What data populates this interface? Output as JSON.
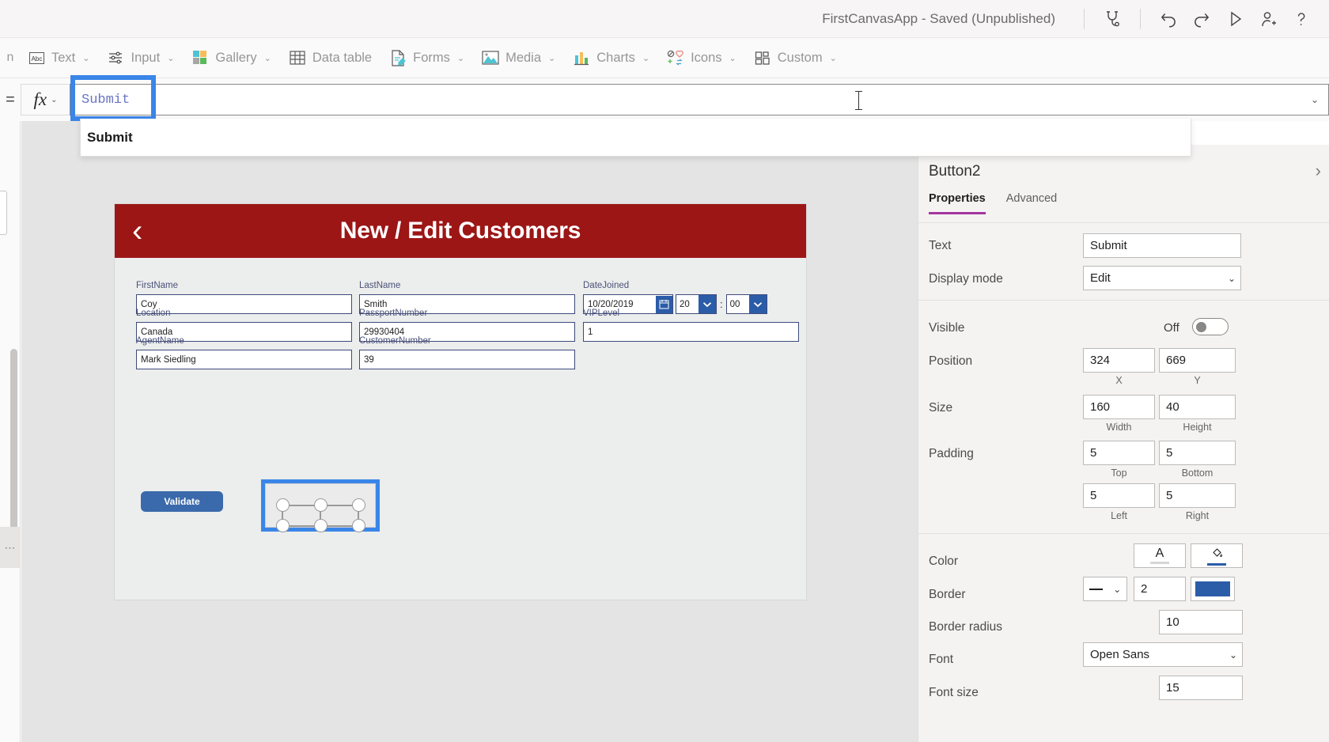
{
  "topbar": {
    "app_title": "FirstCanvasApp - Saved (Unpublished)",
    "icons": [
      {
        "name": "app-checker-icon",
        "label": "App checker"
      },
      {
        "name": "undo-icon",
        "label": "Undo"
      },
      {
        "name": "redo-icon",
        "label": "Redo"
      },
      {
        "name": "preview-play-icon",
        "label": "Preview the app"
      },
      {
        "name": "share-add-user-icon",
        "label": "Share"
      },
      {
        "name": "help-icon",
        "label": "Help"
      }
    ]
  },
  "insert_toolbar": {
    "overflow_left": "n",
    "items": [
      {
        "label": "Text",
        "icon": "text-abc-icon",
        "has_chevron": true
      },
      {
        "label": "Input",
        "icon": "input-sliders-icon",
        "has_chevron": true
      },
      {
        "label": "Gallery",
        "icon": "gallery-squares-icon",
        "has_chevron": true
      },
      {
        "label": "Data table",
        "icon": "data-table-grid-icon",
        "has_chevron": false
      },
      {
        "label": "Forms",
        "icon": "forms-pencil-icon",
        "has_chevron": true
      },
      {
        "label": "Media",
        "icon": "media-image-icon",
        "has_chevron": true
      },
      {
        "label": "Charts",
        "icon": "charts-bar-icon",
        "has_chevron": true
      },
      {
        "label": "Icons",
        "icon": "icons-shapes-icon",
        "has_chevron": true
      },
      {
        "label": "Custom",
        "icon": "custom-blocks-icon",
        "has_chevron": true
      }
    ],
    "chevron_glyph": "⌄"
  },
  "formula_bar": {
    "property_equals": "=",
    "fx_glyph": "fx",
    "fx_chevron": "⌄",
    "value": "Submit",
    "dropdown_chevron": "⌄",
    "suggestion": "Submit"
  },
  "canvas": {
    "screen": {
      "title": "New / Edit Customers",
      "back_chevron": "‹",
      "header_color": "#9c1616",
      "fields": [
        {
          "label": "FirstName",
          "value": "Coy"
        },
        {
          "label": "LastName",
          "value": "Smith"
        },
        {
          "label": "Location",
          "value": "Canada"
        },
        {
          "label": "PassportNumber",
          "value": "29930404"
        },
        {
          "label": "AgentName",
          "value": "Mark Siedling"
        },
        {
          "label": "CustomerNumber",
          "value": "39"
        },
        {
          "label": "VIPLevel",
          "value": "1"
        }
      ],
      "date_field": {
        "label": "DateJoined",
        "date": "10/20/2019",
        "hour": "20",
        "separator": ":",
        "minute": "00",
        "dropdown_chevron": "⌄"
      },
      "validate_button": {
        "label": "Validate",
        "color": "#3a6aab"
      },
      "selected_element": {
        "name": "Button2",
        "selection_color": "#3a86e8"
      }
    }
  },
  "properties_panel": {
    "expand_chevron": "›",
    "title": "Button2",
    "tabs": [
      {
        "label": "Properties",
        "active": true
      },
      {
        "label": "Advanced",
        "active": false
      }
    ],
    "accent_color": "#a4359f",
    "rows": {
      "text": {
        "label": "Text",
        "value": "Submit"
      },
      "display_mode": {
        "label": "Display mode",
        "value": "Edit",
        "chevron": "⌄"
      },
      "visible": {
        "label": "Visible",
        "state": "Off"
      },
      "position": {
        "label": "Position",
        "x": "324",
        "y": "669",
        "x_sub": "X",
        "y_sub": "Y"
      },
      "size": {
        "label": "Size",
        "width": "160",
        "height": "40",
        "width_sub": "Width",
        "height_sub": "Height"
      },
      "padding": {
        "label": "Padding",
        "top": "5",
        "bottom": "5",
        "left": "5",
        "right": "5",
        "top_sub": "Top",
        "bottom_sub": "Bottom",
        "left_sub": "Left",
        "right_sub": "Right"
      },
      "color": {
        "label": "Color",
        "text_glyph": "A",
        "text_underline_color": "#d6d6d6",
        "fill_glyph": "⬟",
        "fill_underline_color": "#2b5ca8"
      },
      "border": {
        "label": "Border",
        "style_glyph": "—",
        "chevron": "⌄",
        "thickness": "2",
        "swatch_color": "#2b5ca8"
      },
      "border_radius": {
        "label": "Border radius",
        "value": "10"
      },
      "font": {
        "label": "Font",
        "value": "Open Sans",
        "chevron": "⌄"
      },
      "font_size": {
        "label": "Font size",
        "value": "15"
      }
    }
  }
}
